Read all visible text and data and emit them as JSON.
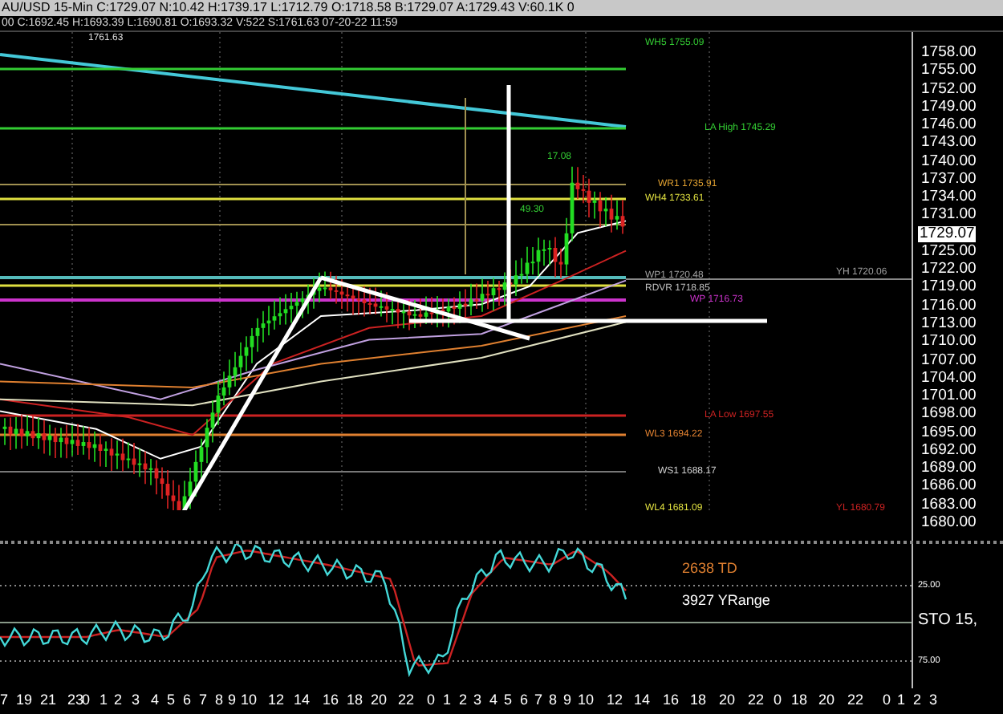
{
  "header": {
    "quote": "AU/USD 15-Min C:1729.07 N:10.42 H:1739.17 L:1712.79 O:1718.58 B:1729.07 A:1729.43 V:60.1K 0",
    "session": "00 C:1692.45 H:1693.39 L:1690.81 O:1693.32 V:522 S:1761.63 07-20-22 11:59"
  },
  "main_chart": {
    "top_value": "1761.63",
    "levels": [
      {
        "label": "WH5 1755.09",
        "color": "#33cc33"
      },
      {
        "label": "LA High 1745.29",
        "color": "#33cc33"
      },
      {
        "label": "17.08",
        "color": "#33cc33"
      },
      {
        "label": "WR1 1735.91",
        "color": "#e0a030"
      },
      {
        "label": "WH4 1733.61",
        "color": "#e0e040"
      },
      {
        "label": "49.30",
        "color": "#33cc33"
      },
      {
        "label": "WP1 1720.48",
        "color": "#a0a0a0"
      },
      {
        "label": "YH 1720.06",
        "color": "#a0a0a0"
      },
      {
        "label": "RDVR 1718.85",
        "color": "#c0c0c0"
      },
      {
        "label": "WP 1716.73",
        "color": "#cc33cc"
      },
      {
        "label": "LA Low 1697.55",
        "color": "#cc2222"
      },
      {
        "label": "WL3 1694.22",
        "color": "#e08030"
      },
      {
        "label": "WS1 1688.17",
        "color": "#d0d0d0"
      },
      {
        "label": "WL4 1681.09",
        "color": "#e0e040"
      },
      {
        "label": "YL 1680.79",
        "color": "#cc2222"
      }
    ],
    "price_axis": [
      {
        "label": "1758.00",
        "kind": "tick"
      },
      {
        "label": "1755.00",
        "kind": "tick"
      },
      {
        "label": "1752.00",
        "kind": "tick"
      },
      {
        "label": "1749.00",
        "kind": "tick"
      },
      {
        "label": "1746.00",
        "kind": "tick"
      },
      {
        "label": "1743.00",
        "kind": "tick"
      },
      {
        "label": "1740.00",
        "kind": "tick"
      },
      {
        "label": "1737.00",
        "kind": "tick"
      },
      {
        "label": "1734.00",
        "kind": "tick"
      },
      {
        "label": "1731.00",
        "kind": "tick"
      },
      {
        "label": "1729.07",
        "kind": "current"
      },
      {
        "label": "1725.00",
        "kind": "tick"
      },
      {
        "label": "1722.00",
        "kind": "tick"
      },
      {
        "label": "1719.00",
        "kind": "tick"
      },
      {
        "label": "1716.00",
        "kind": "tick"
      },
      {
        "label": "1713.00",
        "kind": "tick"
      },
      {
        "label": "1710.00",
        "kind": "tick"
      },
      {
        "label": "1707.00",
        "kind": "tick"
      },
      {
        "label": "1704.00",
        "kind": "tick"
      },
      {
        "label": "1701.00",
        "kind": "tick"
      },
      {
        "label": "1698.00",
        "kind": "tick"
      },
      {
        "label": "1695.00",
        "kind": "tick"
      },
      {
        "label": "1692.00",
        "kind": "tick"
      },
      {
        "label": "1689.00",
        "kind": "tick"
      },
      {
        "label": "1686.00",
        "kind": "tick"
      },
      {
        "label": "1683.00",
        "kind": "tick"
      },
      {
        "label": "1680.00",
        "kind": "tick"
      }
    ]
  },
  "indicator": {
    "notes": [
      {
        "label": "2638 TD",
        "color": "#e08030"
      },
      {
        "label": "3927 YRange",
        "color": "#ffffff"
      }
    ],
    "axis": [
      "25.00",
      "STO 15,",
      "75.00"
    ]
  },
  "time_axis": [
    "7",
    "19",
    "21",
    "23",
    "0",
    "1",
    "2",
    "3",
    "4",
    "5",
    "6",
    "7",
    "8",
    "9",
    "10",
    "12",
    "14",
    "16",
    "18",
    "20",
    "22",
    "0",
    "1",
    "2",
    "3",
    "4",
    "5",
    "6",
    "7",
    "8",
    "9",
    "10",
    "12",
    "14",
    "16",
    "18",
    "20",
    "22",
    "0",
    "18",
    "20",
    "22",
    "0",
    "1",
    "2",
    "3"
  ]
}
